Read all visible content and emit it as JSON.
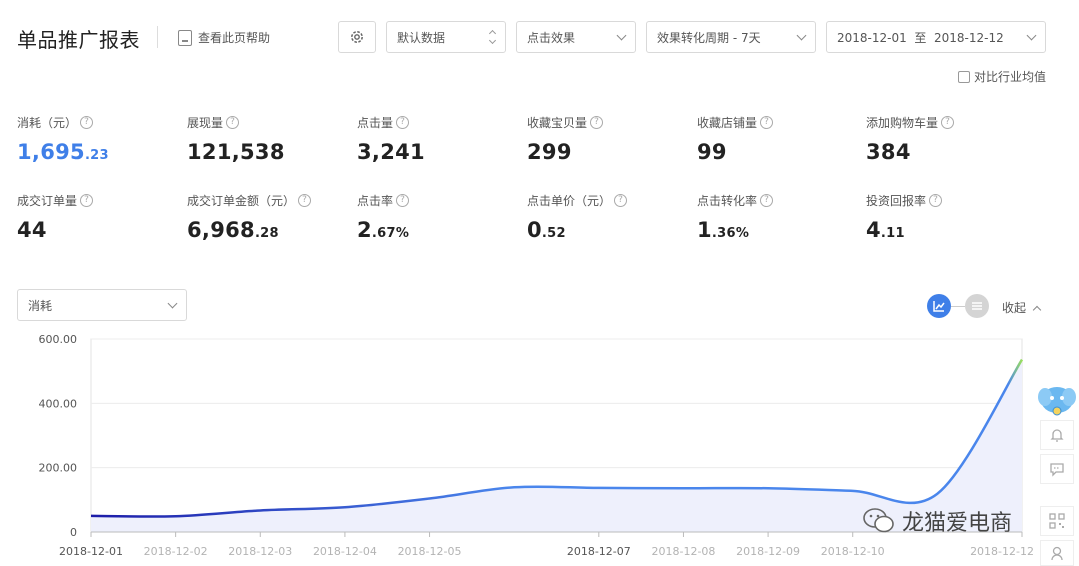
{
  "header": {
    "title": "单品推广报表",
    "help_label": "查看此页帮助",
    "data_select": "默认数据",
    "effect_select": "点击效果",
    "period_select": "效果转化周期 - 7天",
    "date_range": "2018-12-01  至  2018-12-12",
    "compare_label": "对比行业均值"
  },
  "metrics": [
    {
      "label": "消耗（元）",
      "int": "1,695",
      "dec": ".23",
      "highlight": true
    },
    {
      "label": "展现量",
      "int": "121,538",
      "dec": ""
    },
    {
      "label": "点击量",
      "int": "3,241",
      "dec": ""
    },
    {
      "label": "收藏宝贝量",
      "int": "299",
      "dec": ""
    },
    {
      "label": "收藏店铺量",
      "int": "99",
      "dec": ""
    },
    {
      "label": "添加购物车量",
      "int": "384",
      "dec": ""
    },
    {
      "label": "成交订单量",
      "int": "44",
      "dec": ""
    },
    {
      "label": "成交订单金额（元）",
      "int": "6,968",
      "dec": ".28"
    },
    {
      "label": "点击率",
      "int": "2",
      "dec": ".67%"
    },
    {
      "label": "点击单价（元）",
      "int": "0",
      "dec": ".52"
    },
    {
      "label": "点击转化率",
      "int": "1",
      "dec": ".36%"
    },
    {
      "label": "投资回报率",
      "int": "4",
      "dec": ".11"
    }
  ],
  "chart_controls": {
    "metric_select": "消耗",
    "collapse_label": "收起",
    "help_mark": "?"
  },
  "chart_data": {
    "type": "area",
    "title": "",
    "xlabel": "",
    "ylabel": "",
    "y_ticks": [
      "600.00",
      "400.00",
      "200.00",
      "0"
    ],
    "ylim": [
      0,
      600
    ],
    "x_ticks": [
      {
        "label": "2018-12-01",
        "faint": false
      },
      {
        "label": "2018-12-02",
        "faint": true
      },
      {
        "label": "2018-12-03",
        "faint": true
      },
      {
        "label": "2018-12-04",
        "faint": true
      },
      {
        "label": "2018-12-05",
        "faint": true
      },
      {
        "label": "2018-12-07",
        "faint": false
      },
      {
        "label": "2018-12-08",
        "faint": true
      },
      {
        "label": "2018-12-09",
        "faint": true
      },
      {
        "label": "2018-12-10",
        "faint": true
      },
      {
        "label": "2018-12-12",
        "faint": true
      }
    ],
    "x": [
      "2018-12-01",
      "2018-12-02",
      "2018-12-03",
      "2018-12-04",
      "2018-12-05",
      "2018-12-06",
      "2018-12-07",
      "2018-12-08",
      "2018-12-09",
      "2018-12-10",
      "2018-12-11",
      "2018-12-12"
    ],
    "values": [
      50,
      49,
      67,
      77,
      104,
      139,
      137,
      136,
      136,
      128,
      119,
      536
    ],
    "grid": true,
    "colors": {
      "line_start": "#1c1ca8",
      "line_end": "#4a86ec",
      "fill": "#eef0fc",
      "tip": "#9be05c"
    }
  },
  "watermark": "龙猫爱电商",
  "icons": [
    "gear-icon",
    "help-book-icon",
    "line-chart-icon",
    "list-icon",
    "bell-icon",
    "chat-icon",
    "qr-icon",
    "mascot-icon"
  ]
}
